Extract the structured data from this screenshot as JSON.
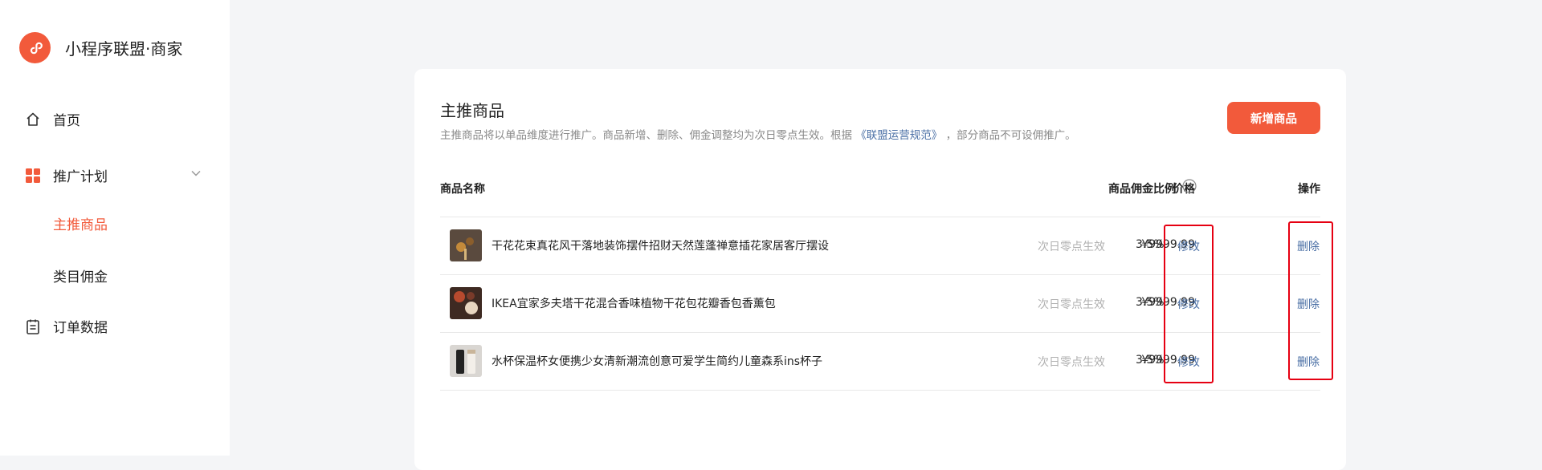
{
  "brand": {
    "name": "小程序联盟·商家",
    "accent": "#f25a3b"
  },
  "sidebar": {
    "home": "首页",
    "plan": "推广计划",
    "plan_children": [
      "主推商品",
      "类目佣金"
    ],
    "orders": "订单数据"
  },
  "main": {
    "title": "主推商品",
    "desc_prefix": "主推商品将以单品维度进行推广。商品新增、删除、佣金调整均为次日零点生效。根据",
    "desc_link": "《联盟运营规范》",
    "desc_suffix": "，部分商品不可设佣推广。",
    "add_button": "新增商品",
    "columns": {
      "name": "商品名称",
      "price": "价格",
      "rate": "商品佣金比例",
      "action": "操作"
    },
    "rows": [
      {
        "name": "干花花束真花风干落地装饰摆件招财天然莲蓬禅意插花家居客厅摆设",
        "price": "¥9999.99",
        "effective": "次日零点生效",
        "rate": "3.5%",
        "edit": "修改",
        "delete": "删除"
      },
      {
        "name": "IKEA宜家多夫塔干花混合香味植物干花包花瓣香包香薰包",
        "price": "¥9999.99",
        "effective": "次日零点生效",
        "rate": "3.5%",
        "edit": "修改",
        "delete": "删除"
      },
      {
        "name": "水杯保温杯女便携少女清新潮流创意可爱学生简约儿童森系ins杯子",
        "price": "¥9999.99",
        "effective": "次日零点生效",
        "rate": "3.5%",
        "edit": "修改",
        "delete": "删除"
      }
    ]
  }
}
